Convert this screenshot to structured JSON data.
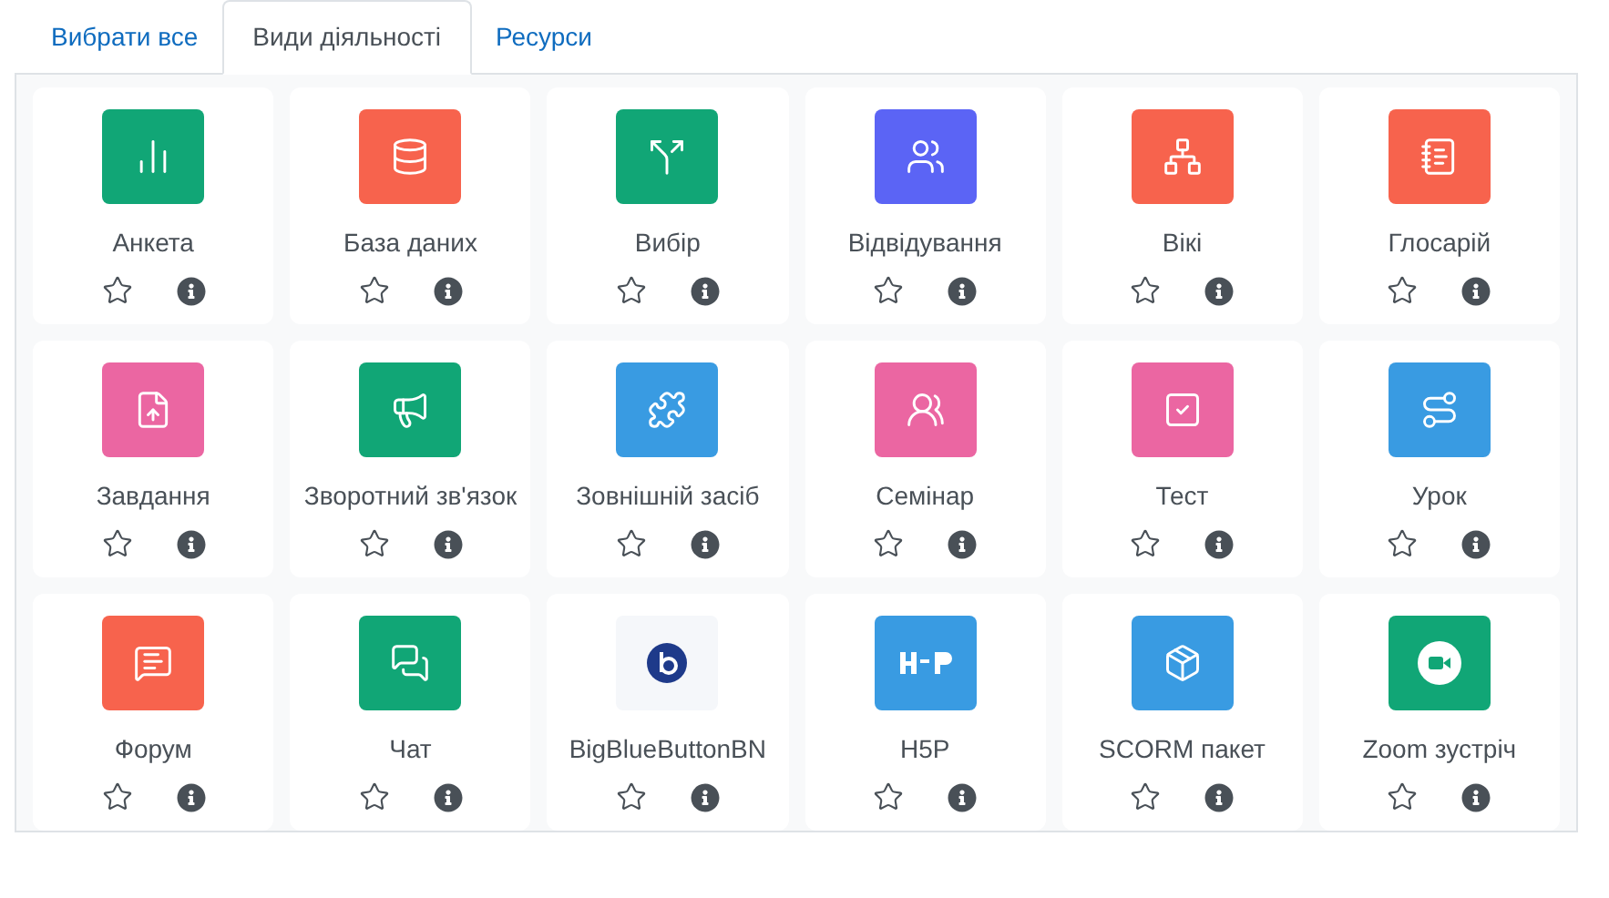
{
  "tabs": [
    {
      "label": "Вибрати все",
      "selected": false
    },
    {
      "label": "Види діяльності",
      "selected": true
    },
    {
      "label": "Ресурси",
      "selected": false
    }
  ],
  "modules": [
    {
      "label": "Анкета",
      "color": "#11a676",
      "starred": false
    },
    {
      "label": "База даних",
      "color": "#f7634d",
      "starred": false
    },
    {
      "label": "Вибір",
      "color": "#11a676",
      "starred": false
    },
    {
      "label": "Відвідування",
      "color": "#5b64f5",
      "starred": false
    },
    {
      "label": "Вікі",
      "color": "#f7634d",
      "starred": false
    },
    {
      "label": "Глосарій",
      "color": "#f7634d",
      "starred": false
    },
    {
      "label": "Завдання",
      "color": "#eb66a2",
      "starred": false
    },
    {
      "label": "Зворотний зв'язок",
      "color": "#11a676",
      "starred": false
    },
    {
      "label": "Зовнішній засіб",
      "color": "#399be2",
      "starred": false
    },
    {
      "label": "Семінар",
      "color": "#eb66a2",
      "starred": false
    },
    {
      "label": "Тест",
      "color": "#eb66a2",
      "starred": false
    },
    {
      "label": "Урок",
      "color": "#399be2",
      "starred": false
    },
    {
      "label": "Форум",
      "color": "#f7634d",
      "starred": false
    },
    {
      "label": "Чат",
      "color": "#11a676",
      "starred": false
    },
    {
      "label": "BigBlueButtonBN",
      "color": "#f5f7fa",
      "starred": false
    },
    {
      "label": "H5P",
      "color": "#399be2",
      "starred": false
    },
    {
      "label": "SCORM пакет",
      "color": "#399be2",
      "starred": false
    },
    {
      "label": "Zoom зустріч",
      "color": "#11a676",
      "starred": false
    }
  ]
}
